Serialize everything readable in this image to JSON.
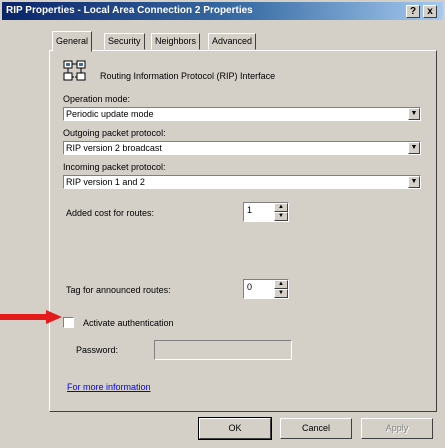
{
  "window": {
    "title": "RIP Properties - Local Area Connection 2 Properties",
    "help_button": "?",
    "close_button": "x"
  },
  "tabs": [
    {
      "label": "General",
      "active": true
    },
    {
      "label": "Security",
      "active": false
    },
    {
      "label": "Neighbors",
      "active": false
    },
    {
      "label": "Advanced",
      "active": false
    }
  ],
  "header": {
    "icon": "network-router-icon",
    "text": "Routing Information Protocol (RIP) Interface"
  },
  "operation_mode": {
    "label": "Operation mode:",
    "value": "Periodic update mode"
  },
  "outgoing": {
    "label": "Outgoing packet protocol:",
    "value": "RIP version 2 broadcast"
  },
  "incoming": {
    "label": "Incoming packet protocol:",
    "value": "RIP version 1 and 2"
  },
  "added_cost": {
    "label": "Added cost for routes:",
    "value": "1"
  },
  "route_tag": {
    "label": "Tag for announced routes:",
    "value": "0"
  },
  "authentication": {
    "label": "Activate authentication",
    "checked": false
  },
  "password": {
    "label": "Password:",
    "value": ""
  },
  "more_info_link": "For more information",
  "buttons": {
    "ok": "OK",
    "cancel": "Cancel",
    "apply": "Apply"
  },
  "colors": {
    "annotation_arrow": "#e31b1b",
    "title_start": "#0a246a",
    "title_end": "#a6caf0"
  }
}
